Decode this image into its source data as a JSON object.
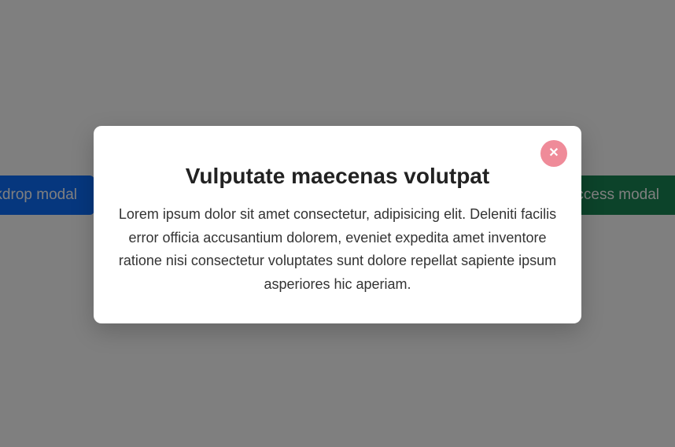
{
  "buttons": {
    "left_label": "Static backdrop modal",
    "right_label": "Success modal"
  },
  "modal": {
    "title": "Vulputate maecenas volutpat",
    "body": "Lorem ipsum dolor sit amet consectetur, adipisicing elit. Deleniti facilis error officia accusantium dolorem, eveniet expedita amet inventore ratione nisi consectetur voluptates sunt dolore repellat sapiente ipsum asperiores hic aperiam.",
    "close_char": "✕"
  }
}
